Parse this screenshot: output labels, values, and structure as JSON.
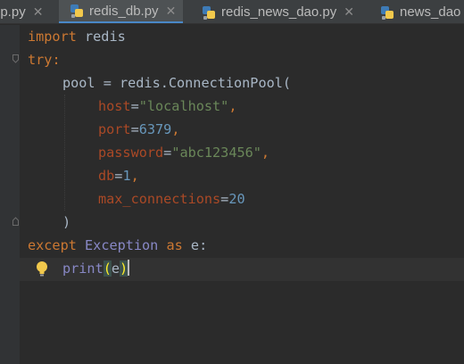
{
  "tabs": [
    {
      "label": "pp.py",
      "active": false
    },
    {
      "label": "redis_db.py",
      "active": true
    },
    {
      "label": "redis_news_dao.py",
      "active": false
    },
    {
      "label": "news_dao",
      "active": false
    }
  ],
  "close_glyph": "✕",
  "code": {
    "line1": {
      "kw": "import",
      "rest": " redis"
    },
    "line2": {
      "kw": "try",
      "punct": ":"
    },
    "line3": {
      "a": "pool = redis.ConnectionPool("
    },
    "line4": {
      "param": "host",
      "eq": "=",
      "val": "\"localhost\"",
      "comma": ","
    },
    "line5": {
      "param": "port",
      "eq": "=",
      "val": "6379",
      "comma": ","
    },
    "line6": {
      "param": "password",
      "eq": "=",
      "val": "\"abc123456\"",
      "comma": ","
    },
    "line7": {
      "param": "db",
      "eq": "=",
      "val": "1",
      "comma": ","
    },
    "line8": {
      "param": "max_connections",
      "eq": "=",
      "val": "20"
    },
    "line9": {
      "a": ")"
    },
    "line10": {
      "kw1": "except",
      "cls": "Exception",
      "kw2": "as",
      "rest": " e:"
    },
    "line11": {
      "fn": "print",
      "open": "(",
      "arg": "e",
      "close": ")"
    }
  },
  "colors": {
    "keyword": "#cc7832",
    "builtin": "#8888c6",
    "string": "#6a8759",
    "number": "#6897bb",
    "param": "#aa4926",
    "text": "#a9b7c6",
    "background": "#2b2b2b"
  },
  "icons": [
    "python-file-icon",
    "close-icon",
    "fold-icon",
    "intention-bulb-icon"
  ]
}
